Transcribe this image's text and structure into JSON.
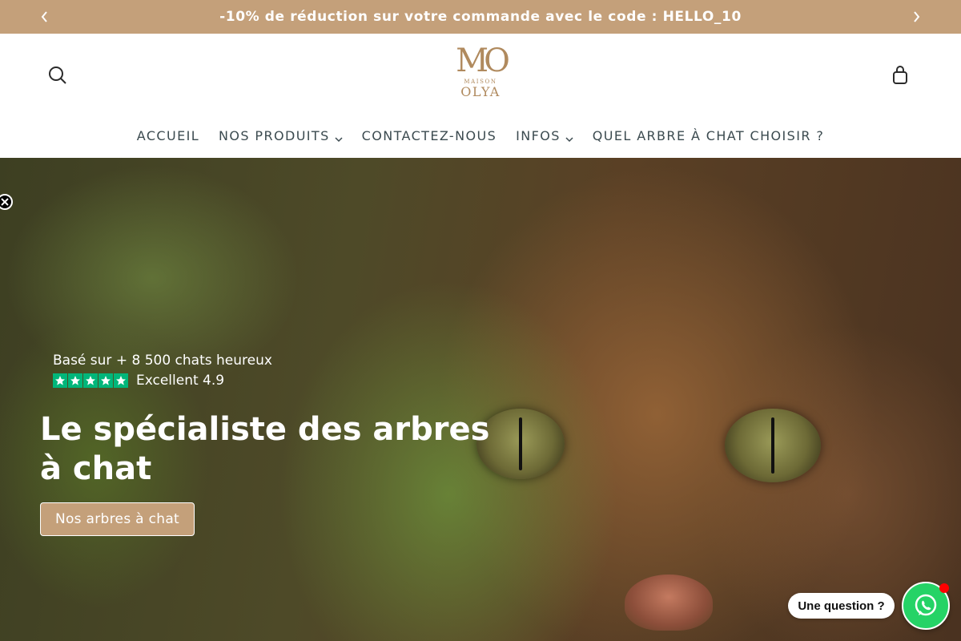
{
  "announcement": {
    "text": "-10% de réduction sur votre commande avec le code : HELLO_10",
    "prev_icon": "chevron-left-icon",
    "next_icon": "chevron-right-icon"
  },
  "header": {
    "logo": {
      "mark": "MO",
      "line1": "MAISON",
      "line2": "OLYA"
    },
    "search_icon": "search-icon",
    "cart_icon": "shopping-bag-icon"
  },
  "nav": {
    "items": [
      {
        "label": "ACCUEIL",
        "has_dropdown": false
      },
      {
        "label": "NOS PRODUITS",
        "has_dropdown": true
      },
      {
        "label": "CONTACTEZ-NOUS",
        "has_dropdown": false
      },
      {
        "label": "INFOS",
        "has_dropdown": true
      },
      {
        "label": "QUEL ARBRE À CHAT CHOISIR ?",
        "has_dropdown": false
      }
    ]
  },
  "hero": {
    "review_line": "Basé sur + 8 500 chats heureux",
    "rating_text": "Excellent 4.9",
    "stars": 5,
    "title": "Le spécialiste des arbres à chat",
    "cta_label": "Nos arbres à chat"
  },
  "widget": {
    "bubble_text": "Une question ?",
    "icon": "whatsapp-icon"
  },
  "colors": {
    "accent": "#c4a07a",
    "nav_text": "#3b4a4f",
    "star_green": "#00b67a",
    "whatsapp": "#25d366"
  }
}
